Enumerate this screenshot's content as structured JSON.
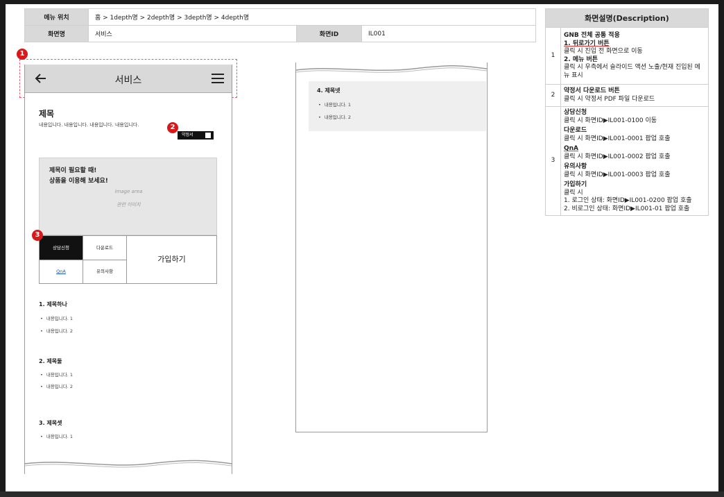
{
  "header": {
    "menu_location_label": "메뉴 위치",
    "menu_location_value": "홈 > 1depth명 > 2depth명 > 3depth명 > 4depth명",
    "screen_name_label": "화면명",
    "screen_name_value": "서비스",
    "screen_id_label": "화면ID",
    "screen_id_value": "IL001"
  },
  "description": {
    "title": "화면설명(Description)",
    "rows": [
      {
        "num": "1",
        "lines": [
          "GNB 전체 공통 적용",
          "1. 뒤로가기 버튼",
          "클릭 시 진입 전 화면으로 이동",
          "2. 메뉴 버튼",
          "클릭 시 우측에서 슬라이드 액션 노출/현재 진입된 메뉴 표시"
        ]
      },
      {
        "num": "2",
        "lines": [
          "약정서 다운로드 버튼",
          "클릭 시 약정서 PDF 파일 다운로드"
        ]
      },
      {
        "num": "3",
        "lines": [
          "상담신청",
          "클릭 시 화면ID▶IL001-0100 이동",
          "다운로드",
          "클릭 시 화면ID▶IL001-0001 팝업 호출",
          "QnA",
          "클릭 시 화면ID▶IL001-0002 팝업 호출",
          "유의사항",
          "클릭 시 화면ID▶IL001-0003 팝업 호출",
          "가입하기",
          "클릭 시",
          "1. 로그인 상태: 화면ID▶IL001-0200 팝업 호출",
          "2. 비로그인 상태: 화면ID▶IL001-01 팝업 호출"
        ]
      }
    ]
  },
  "markers": [
    "1",
    "2",
    "3"
  ],
  "phone": {
    "app_title": "서비스",
    "content_title": "제목",
    "content_text": "내용입니다. 내용입니다. 내용입니다. 내용입니다.",
    "pdf_button": "약정서",
    "banner": {
      "line1": "제목이 필요할 때!",
      "line2": "상품을 이용해 보세요!",
      "image_area": "image area",
      "image_caption": "관련 이미지"
    },
    "buttons": {
      "consult": "상담신청",
      "download": "다운로드",
      "qna": "QnA",
      "notice": "유의사항",
      "join": "가입하기"
    },
    "sections": [
      {
        "title": "1. 제목하나",
        "items": [
          "내용입니다. 1",
          "내용입니다. 2"
        ]
      },
      {
        "title": "2. 제목둘",
        "items": [
          "내용입니다. 1",
          "내용입니다. 2"
        ]
      },
      {
        "title": "3. 제목셋",
        "items": [
          "내용입니다. 1"
        ]
      }
    ]
  },
  "phone2": {
    "section": {
      "title": "4. 제목넷",
      "items": [
        "내용입니다. 1",
        "내용입니다. 2"
      ]
    }
  },
  "colors": {
    "marker": "#d8191c",
    "header_bg": "#d9d9d9",
    "dark_button": "#111111"
  }
}
